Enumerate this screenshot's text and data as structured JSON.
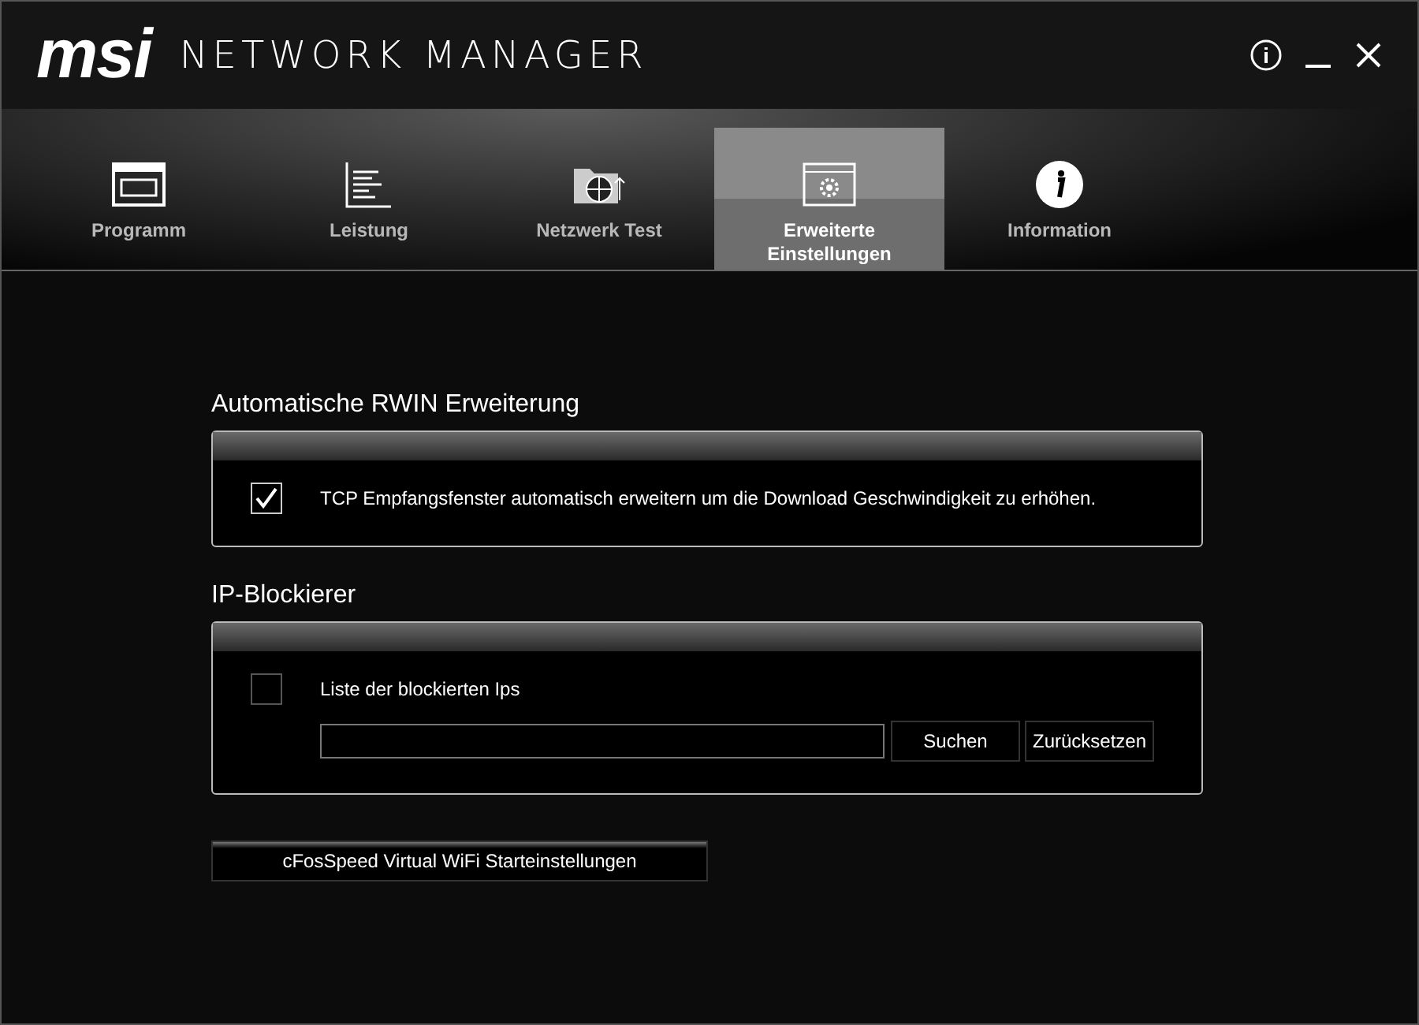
{
  "window": {
    "logo": "msi",
    "title": "NETWORK MANAGER"
  },
  "tabs": [
    {
      "label": "Programm",
      "kind": "window",
      "selected": false
    },
    {
      "label": "Leistung",
      "kind": "lines",
      "selected": false
    },
    {
      "label": "Netzwerk Test",
      "kind": "folder",
      "selected": false
    },
    {
      "label": "Erweiterte Einstellungen",
      "kind": "gear",
      "selected": true
    },
    {
      "label": "Information",
      "kind": "info",
      "selected": false
    }
  ],
  "sections": [
    {
      "title": "Automatische RWIN Erweiterung",
      "checkbox": {
        "label": "TCP Empfangsfenster automatisch erweitern um die Download Geschwindigkeit zu erhöhen.",
        "checked": true
      }
    },
    {
      "title": "IP-Blockierer",
      "checkbox": {
        "label": "Liste der blockierten Ips",
        "checked": false
      },
      "buttons": [
        "Suchen",
        "Zurücksetzen"
      ]
    }
  ],
  "bottom_button": "cFosSpeed Virtual WiFi Starteinstellungen"
}
